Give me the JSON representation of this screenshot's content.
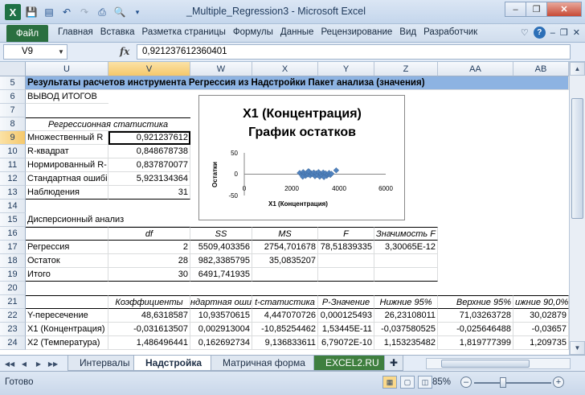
{
  "window": {
    "title": "_Multiple_Regression3  -  Microsoft Excel",
    "minimize_glyph": "–",
    "restore_glyph": "❐",
    "close_glyph": "✕"
  },
  "ribbon": {
    "file_label": "Файл",
    "tabs": [
      "Главная",
      "Вставка",
      "Разметка страницы",
      "Формулы",
      "Данные",
      "Рецензирование",
      "Вид",
      "Разработчик"
    ]
  },
  "formula_bar": {
    "name_box": "V9",
    "fx": "fx",
    "formula": "0,921237612360401"
  },
  "columns": [
    "U",
    "V",
    "W",
    "X",
    "Y",
    "Z",
    "AA",
    "AB"
  ],
  "rows": [
    "5",
    "6",
    "7",
    "8",
    "9",
    "10",
    "11",
    "12",
    "13",
    "14",
    "15",
    "16",
    "17",
    "18",
    "19",
    "20",
    "21",
    "22",
    "23",
    "24"
  ],
  "cells": {
    "r5": "Результаты расчетов инструмента Регрессия из Надстройки Пакет анализа (значения)",
    "r6": "ВЫВОД ИТОГОВ",
    "r8": "Регрессионная статистика",
    "r9": [
      "Множественный R",
      "0,921237612"
    ],
    "r10": [
      "R-квадрат",
      "0,848678738"
    ],
    "r11": [
      "Нормированный R-",
      "0,837870077"
    ],
    "r12": [
      "Стандартная ошибі",
      "5,923134364"
    ],
    "r13": [
      "Наблюдения",
      "31"
    ],
    "r15": "Дисперсионный анализ",
    "r16": [
      "",
      "df",
      "SS",
      "MS",
      "F",
      "Значимость F"
    ],
    "r17": [
      "Регрессия",
      "2",
      "5509,403356",
      "2754,701678",
      "78,51839335",
      "3,30065E-12"
    ],
    "r18": [
      "Остаток",
      "28",
      "982,3385795",
      "35,0835207",
      "",
      ""
    ],
    "r19": [
      "Итого",
      "30",
      "6491,741935",
      "",
      "",
      ""
    ],
    "r21": [
      "",
      "Коэффициенты",
      "андартная ошиб",
      "t-статистика",
      "P-Значение",
      "Нижние 95%",
      "Верхние 95%",
      "ижние 90,0%"
    ],
    "r22": [
      "Y-пересечение",
      "48,6318587",
      "10,93570615",
      "4,447070726",
      "0,000125493",
      "26,23108011",
      "71,03263728",
      "30,02879"
    ],
    "r23": [
      "X1 (Концентрация)",
      "-0,031613507",
      "0,002913004",
      "-10,85254462",
      "1,53445E-11",
      "-0,037580525",
      "-0,025646488",
      "-0,03657"
    ],
    "r24": [
      "X2 (Температура)",
      "1,486496441",
      "0,162692734",
      "9,136833611",
      "6,79072E-10",
      "1,153235482",
      "1,819777399",
      "1,209735"
    ]
  },
  "chart": {
    "title_line1": "X1 (Концентрация)",
    "title_line2": "График остатков",
    "xlabel": "X1 (Концентрация)",
    "ylabel": "Остатки",
    "yticks": [
      "50",
      "0",
      "-50"
    ],
    "xticks": [
      "0",
      "2000",
      "4000",
      "6000"
    ]
  },
  "chart_data": {
    "type": "scatter",
    "title": "X1 (Концентрация) График остатков",
    "xlabel": "X1 (Концентрация)",
    "ylabel": "Остатки",
    "xlim": [
      0,
      6000
    ],
    "ylim": [
      -50,
      50
    ],
    "marker_color": "#4f81bd",
    "points": [
      [
        2350,
        3
      ],
      [
        2450,
        -2
      ],
      [
        2500,
        5
      ],
      [
        2550,
        1
      ],
      [
        2600,
        -4
      ],
      [
        2650,
        3
      ],
      [
        2700,
        -1
      ],
      [
        2750,
        6
      ],
      [
        2800,
        -3
      ],
      [
        2850,
        2
      ],
      [
        2900,
        0
      ],
      [
        2950,
        4
      ],
      [
        3000,
        -5
      ],
      [
        3050,
        2
      ],
      [
        3100,
        -2
      ],
      [
        3150,
        5
      ],
      [
        3200,
        -6
      ],
      [
        3250,
        1
      ],
      [
        3300,
        -3
      ],
      [
        3350,
        4
      ],
      [
        3400,
        -1
      ],
      [
        3450,
        2
      ],
      [
        3500,
        -4
      ],
      [
        3550,
        0
      ],
      [
        3600,
        3
      ],
      [
        3650,
        -2
      ],
      [
        3700,
        1
      ],
      [
        2480,
        -6
      ],
      [
        2720,
        7
      ],
      [
        3380,
        -7
      ],
      [
        3900,
        9
      ]
    ]
  },
  "sheets": {
    "tabs": [
      "Интервалы",
      "Надстройка",
      "Матричная форма",
      "EXCEL2.RU"
    ],
    "active": "Надстройка"
  },
  "status": {
    "ready": "Готово",
    "zoom": "85%"
  },
  "colors": {
    "header_fill": "#8db3e2",
    "file_tab": "#2a6f3f",
    "selected_header": "#f5c86b"
  }
}
